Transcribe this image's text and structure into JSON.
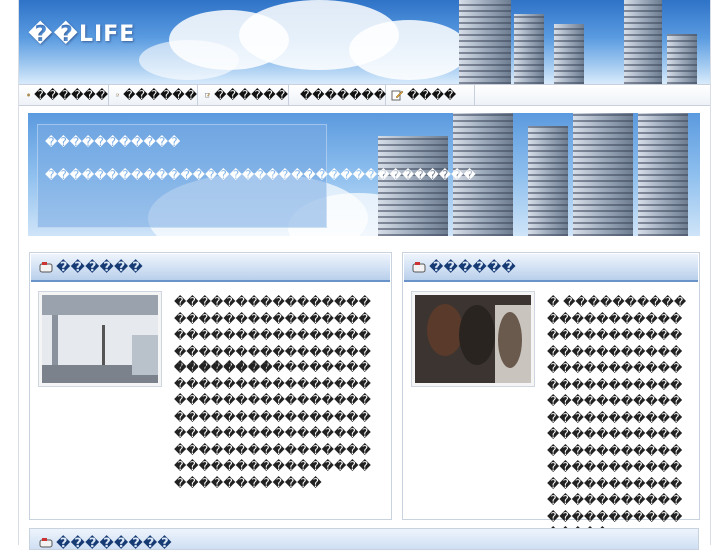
{
  "site": {
    "logo": "��LIFE"
  },
  "nav": [
    {
      "label": "������",
      "icon": "home-icon"
    },
    {
      "label": "������",
      "icon": "edit-icon"
    },
    {
      "label": "������",
      "icon": "edit-icon"
    },
    {
      "label": "�������",
      "icon": "edit-icon"
    },
    {
      "label": "����",
      "icon": "edit-icon"
    }
  ],
  "banner": {
    "line1": "�����������",
    "line2": "�����������������������������������"
  },
  "left_box": {
    "title": "������",
    "icon": "mailbox-icon",
    "para1": "������������������������������������������������������������������������",
    "para2": "����������������������������������������������������������������������������������������������������������������������������"
  },
  "right_box": {
    "title": "������",
    "icon": "mailbox-icon",
    "para1": "� ��������������������������������������������������������������������������������������������������������������������������������������������������������������"
  },
  "bottom_box": {
    "title": "��������",
    "icon": "mailbox-icon"
  },
  "colors": {
    "accent": "#6a93c9",
    "heading": "#163a73",
    "sky": "#5a9be0"
  }
}
